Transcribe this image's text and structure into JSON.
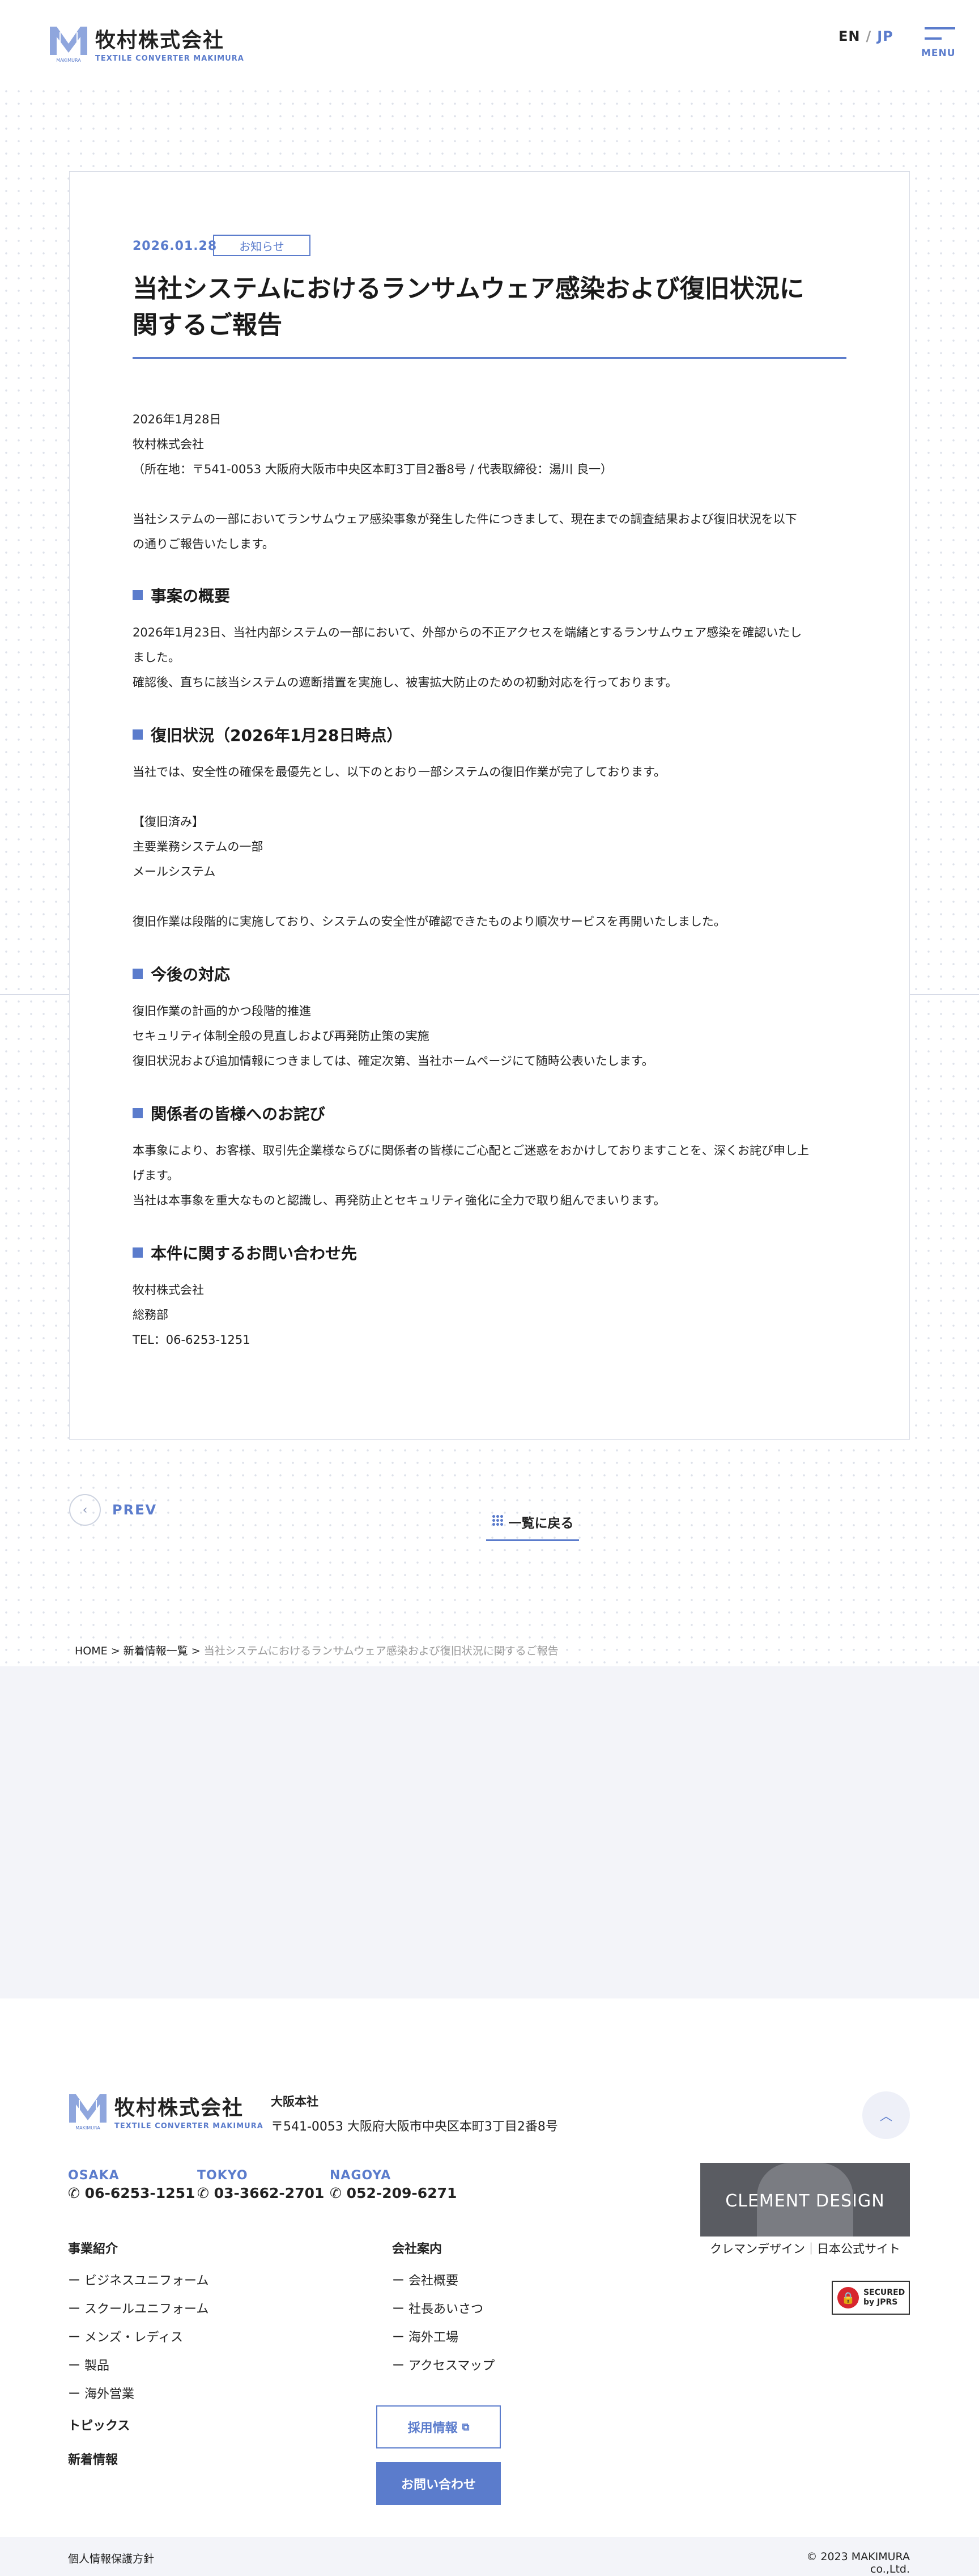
{
  "header": {
    "logo_jp": "牧村株式会社",
    "logo_en": "TEXTILE CONVERTER MAKIMURA",
    "logo_mark_text": "MAKIMURA",
    "lang_en": "EN",
    "lang_sep": "/",
    "lang_jp": "JP",
    "menu_label": "MENU"
  },
  "article": {
    "date": "2026.01.28",
    "category": "お知らせ",
    "title_line1": "当社システムにおけるランサムウェア感染および復旧状況に",
    "title_line2": "関するご報告",
    "issue_date": "2026年1月28日",
    "company": "牧村株式会社",
    "address": "（所在地：〒541-0053 大阪府大阪市中央区本町3丁目2番8号 / 代表取締役：湯川 良一）",
    "intro_1": "当社システムの一部においてランサムウェア感染事象が発生した件につきまして、現在までの調査結果および復旧状況を以下",
    "intro_2": "の通りご報告いたします。",
    "s1_heading": "事案の概要",
    "s1_p1": "2026年1月23日、当社内部システムの一部において、外部からの不正アクセスを端緒とするランサムウェア感染を確認いたし",
    "s1_p2": "ました。",
    "s1_p3": "確認後、直ちに該当システムの遮断措置を実施し、被害拡大防止のための初動対応を行っております。",
    "s2_heading": "復旧状況（2026年1月28日時点）",
    "s2_p1": "当社では、安全性の確保を最優先とし、以下のとおり一部システムの復旧作業が完了しております。",
    "s2_p2": "【復旧済み】",
    "s2_p3": "主要業務システムの一部",
    "s2_p4": "メールシステム",
    "s2_p5": "復旧作業は段階的に実施しており、システムの安全性が確認できたものより順次サービスを再開いたしました。",
    "s3_heading": "今後の対応",
    "s3_p1": "復旧作業の計画的かつ段階的推進",
    "s3_p2": "セキュリティ体制全般の見直しおよび再発防止策の実施",
    "s3_p3": "復旧状況および追加情報につきましては、確定次第、当社ホームページにて随時公表いたします。",
    "s4_heading": "関係者の皆様へのお詫び",
    "s4_p1": "本事象により、お客様、取引先企業様ならびに関係者の皆様にご心配とご迷惑をおかけしておりますことを、深くお詫び申し上",
    "s4_p2": "げます。",
    "s4_p3": "当社は本事象を重大なものと認識し、再発防止とセキュリティ強化に全力で取り組んでまいります。",
    "s5_heading": "本件に関するお問い合わせ先",
    "s5_p1": "牧村株式会社",
    "s5_p2": "総務部",
    "s5_p3": "TEL：06-6253-1251"
  },
  "pager": {
    "prev_label": "PREV",
    "back_label": "一覧に戻る"
  },
  "breadcrumb": {
    "home": "HOME",
    "sep": ">",
    "news": "新着情報一覧",
    "current": "当社システムにおけるランサムウェア感染および復旧状況に関するご報告"
  },
  "footer": {
    "office_title": "大阪本社",
    "office_address": "〒541-0053 大阪府大阪市中央区本町3丁目2番8号",
    "cities": [
      {
        "name": "OSAKA",
        "tel": "06-6253-1251"
      },
      {
        "name": "TOKYO",
        "tel": "03-3662-2701"
      },
      {
        "name": "NAGOYA",
        "tel": "052-209-6271"
      }
    ],
    "col1_heading": "事業紹介",
    "col1_items": [
      "ー ビジネスユニフォーム",
      "ー スクールユニフォーム",
      "ー メンズ・レディス",
      "ー 製品",
      "ー 海外営業"
    ],
    "topics": "トピックス",
    "news": "新着情報",
    "col2_heading": "会社案内",
    "col2_items": [
      "ー 会社概要",
      "ー 社長あいさつ",
      "ー 海外工場",
      "ー アクセスマップ"
    ],
    "recruit_btn": "採用情報",
    "contact_btn": "お問い合わせ",
    "clement_banner": "CLEMENT DESIGN",
    "clement_caption": "クレマンデザイン｜日本公式サイト",
    "secured_1": "SECURED",
    "secured_2": "by JPRS",
    "privacy": "個人情報保護方針",
    "copyright": "© 2023 MAKIMURA co.,Ltd."
  },
  "colors": {
    "accent": "#5b7ccc",
    "grey_bg": "#f3f4f9",
    "text": "#222222"
  }
}
